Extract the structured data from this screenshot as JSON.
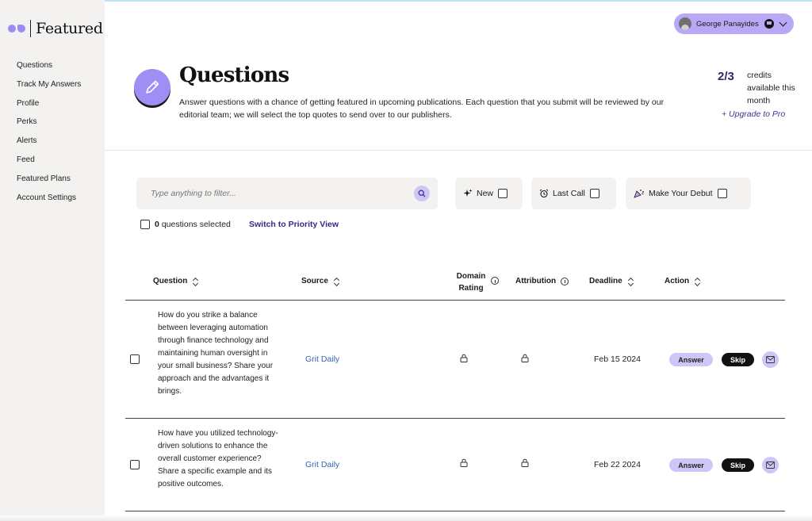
{
  "app": {
    "logo_text": "Featured"
  },
  "sidebar": {
    "items": [
      {
        "label": "Questions"
      },
      {
        "label": "Track My Answers"
      },
      {
        "label": "Profile"
      },
      {
        "label": "Perks"
      },
      {
        "label": "Alerts"
      },
      {
        "label": "Feed"
      },
      {
        "label": "Featured Plans"
      },
      {
        "label": "Account Settings"
      }
    ]
  },
  "user": {
    "name": "George Panayides"
  },
  "header": {
    "title": "Questions",
    "description": "Answer questions with a chance of getting featured in upcoming publications. Each question that you submit will be reviewed by our editorial team; we will select the top quotes to send over to our publishers.",
    "credits_value": "2/3",
    "credits_label": "credits available this month",
    "upgrade_label": "+ Upgrade to Pro"
  },
  "filters": {
    "search_placeholder": "Type anything to filter...",
    "chips": [
      {
        "label": "New"
      },
      {
        "label": "Last Call"
      },
      {
        "label": "Make Your Debut"
      }
    ],
    "selected_count": "0",
    "selected_label": "questions selected",
    "priority_link": "Switch to Priority View"
  },
  "table": {
    "columns": {
      "question": "Question",
      "source": "Source",
      "domain_rating_1": "Domain",
      "domain_rating_2": "Rating",
      "attribution": "Attribution",
      "deadline": "Deadline",
      "action": "Action"
    },
    "rows": [
      {
        "question": "How do you strike a balance between leveraging automation through finance technology and maintaining human oversight in your small business? Share your approach and the advantages it brings.",
        "source": "Grit Daily",
        "deadline": "Feb 15 2024",
        "answer_label": "Answer",
        "skip_label": "Skip"
      },
      {
        "question": "How have you utilized technology-driven solutions to enhance the overall customer experience? Share a specific example and its positive outcomes.",
        "source": "Grit Daily",
        "deadline": "Feb 22 2024",
        "answer_label": "Answer",
        "skip_label": "Skip"
      }
    ]
  },
  "colors": {
    "accent": "#a18ef5",
    "accent_light": "#cfc6f7",
    "link": "#3a62b5",
    "dark_link": "#2f2a8a",
    "sidebar_bg": "#f3f2f0"
  }
}
